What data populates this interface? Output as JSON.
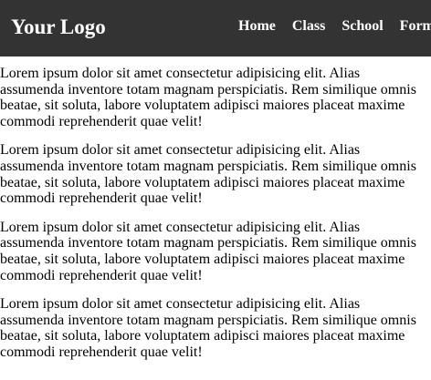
{
  "header": {
    "logo": "Your Logo",
    "nav": [
      {
        "label": "Home"
      },
      {
        "label": "Class"
      },
      {
        "label": "School"
      },
      {
        "label": "Form"
      }
    ]
  },
  "main": {
    "paragraphs": [
      {
        "text": "Lorem ipsum dolor sit amet consectetur adipisicing elit. Alias assumenda inventore totam magnam perspiciatis. Rem similique omnis beatae, sit soluta, labore voluptatem adipisci maiores placeat maxime commodi reprehenderit quae velit!"
      },
      {
        "text": "Lorem ipsum dolor sit amet consectetur adipisicing elit. Alias assumenda inventore totam magnam perspiciatis. Rem similique omnis beatae, sit soluta, labore voluptatem adipisci maiores placeat maxime commodi reprehenderit quae velit!"
      },
      {
        "text": "Lorem ipsum dolor sit amet consectetur adipisicing elit. Alias assumenda inventore totam magnam perspiciatis. Rem similique omnis beatae, sit soluta, labore voluptatem adipisci maiores placeat maxime commodi reprehenderit quae velit!"
      },
      {
        "text": "Lorem ipsum dolor sit amet consectetur adipisicing elit. Alias assumenda inventore totam magnam perspiciatis. Rem similique omnis beatae, sit soluta, labore voluptatem adipisci maiores placeat maxime commodi reprehenderit quae velit!"
      }
    ]
  },
  "colors": {
    "navbar_bg": "#333333",
    "nav_text": "#ffffff",
    "body_text": "#000000",
    "page_bg": "#ffffff"
  }
}
